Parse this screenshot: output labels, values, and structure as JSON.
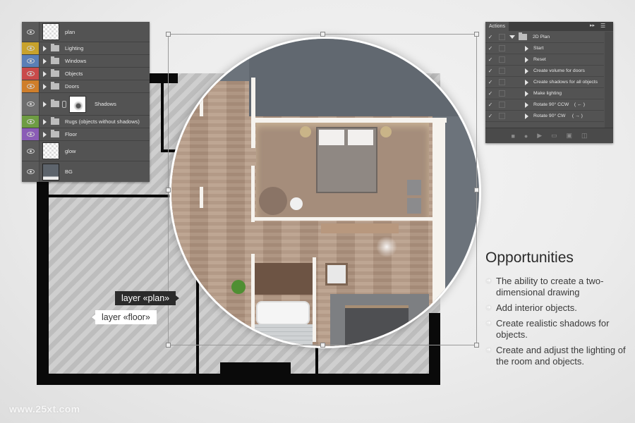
{
  "layers_panel": {
    "items": [
      {
        "name": "plan",
        "type": "layer",
        "color": "#5a5a5a",
        "thumb": "transparent"
      },
      {
        "name": "Lighting",
        "type": "group",
        "color": "#c8a22c"
      },
      {
        "name": "Windows",
        "type": "group",
        "color": "#5a7fb6"
      },
      {
        "name": "Objects",
        "type": "group",
        "color": "#c94a4a"
      },
      {
        "name": "Doors",
        "type": "group",
        "color": "#cf7e2a"
      },
      {
        "name": "Shadows",
        "type": "group-linked",
        "color": "#6e6e6e",
        "thumb": "shadows"
      },
      {
        "name": "Rugs (objects without shadows)",
        "type": "group",
        "color": "#6e9c43"
      },
      {
        "name": "Floor",
        "type": "group",
        "color": "#8a5cb6"
      },
      {
        "name": "glow",
        "type": "layer",
        "color": "#5a5a5a",
        "thumb": "transparent"
      },
      {
        "name": "BG",
        "type": "layer",
        "color": "#5a5a5a",
        "thumb": "bg"
      }
    ]
  },
  "actions_panel": {
    "tab_label": "Actions",
    "collapse_icon": "double-chevron-right-icon",
    "menu_icon": "panel-menu-icon",
    "set_name": "2D Plan",
    "actions": [
      "Start",
      "Reset",
      "Create volume for doors",
      "Create shadows for all objects",
      "Make lighting",
      "Rotate 90° CCW    ( ← )",
      "Rotate 90° CW     ( → )"
    ],
    "toolbar_icons": [
      "stop-icon",
      "record-icon",
      "play-icon",
      "new-set-folder-icon",
      "new-action-icon",
      "delete-icon"
    ]
  },
  "callouts": {
    "plan": "layer «plan»",
    "floor": "layer «floor»"
  },
  "opportunities": {
    "title": "Opportunities",
    "items": [
      "The ability to create a two-dimensional drawing",
      "Add interior objects.",
      "Create realistic shadows for objects.",
      "Create and adjust the lighting of the room and objects."
    ]
  },
  "watermark": "www.25xt.com"
}
